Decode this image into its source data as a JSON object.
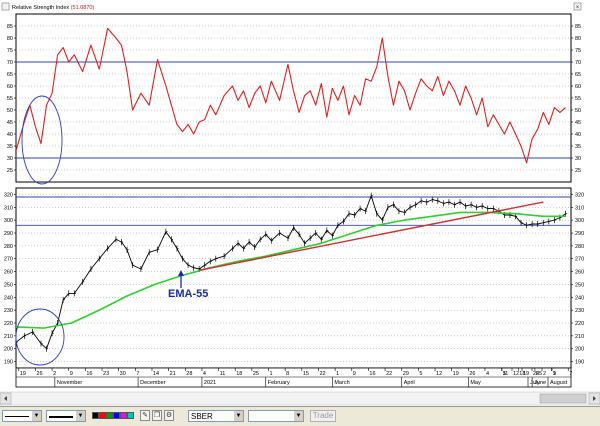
{
  "chart_data": [
    {
      "type": "line",
      "title": "Relative Strength Index",
      "current_value": "(51.0870)",
      "ylim": [
        20,
        90
      ],
      "yticks": [
        25,
        30,
        35,
        40,
        45,
        50,
        55,
        60,
        65,
        70,
        75,
        80,
        85
      ],
      "reference_lines": [
        30,
        70
      ],
      "x_index_range": [
        0,
        200
      ],
      "series": [
        {
          "color": "#e02020",
          "x": [
            0,
            3,
            5,
            7,
            9,
            11,
            13,
            15,
            17,
            19,
            21,
            24,
            27,
            30,
            33,
            36,
            38,
            40,
            42,
            45,
            48,
            51,
            54,
            56,
            58,
            60,
            62,
            64,
            66,
            68,
            70,
            72,
            75,
            78,
            80,
            82,
            84,
            86,
            88,
            90,
            92,
            95,
            98,
            100,
            102,
            104,
            106,
            108,
            110,
            112,
            114,
            116,
            118,
            120,
            122,
            124,
            126,
            128,
            130,
            132,
            134,
            136,
            138,
            140,
            142,
            144,
            146,
            148,
            150,
            152,
            154,
            156,
            158,
            160,
            162,
            164,
            166,
            168,
            170,
            172,
            174,
            176,
            178,
            180,
            182,
            184,
            186,
            188,
            190,
            192,
            194,
            196,
            198
          ],
          "values": [
            33,
            45,
            52,
            43,
            36,
            52,
            57,
            73,
            76,
            70,
            73,
            66,
            77,
            67,
            84,
            80,
            77,
            66,
            50,
            57,
            52,
            71,
            60,
            52,
            44,
            41,
            44,
            40,
            45,
            46,
            52,
            48,
            56,
            60,
            54,
            58,
            51,
            57,
            60,
            53,
            62,
            54,
            69,
            58,
            49,
            56,
            58,
            52,
            61,
            47,
            59,
            54,
            60,
            48,
            56,
            52,
            63,
            62,
            68,
            80,
            64,
            52,
            62,
            58,
            50,
            57,
            63,
            60,
            58,
            64,
            56,
            62,
            58,
            52,
            60,
            55,
            48,
            55,
            43,
            48,
            44,
            40,
            45,
            40,
            35,
            28,
            38,
            42,
            49,
            44,
            51,
            49,
            51
          ]
        }
      ],
      "annotation": "circle around the October low"
    },
    {
      "type": "line",
      "ticker": "SBER",
      "ylim": [
        185,
        325
      ],
      "yticks": [
        190,
        200,
        210,
        220,
        230,
        240,
        250,
        260,
        270,
        280,
        290,
        300,
        310,
        320
      ],
      "reference_lines": [
        296,
        318
      ],
      "x_index_range": [
        0,
        200
      ],
      "series": [
        {
          "color": "#000000",
          "x": [
            0,
            3,
            6,
            9,
            11,
            13,
            15,
            17,
            19,
            21,
            24,
            27,
            30,
            33,
            36,
            38,
            40,
            42,
            45,
            48,
            51,
            54,
            56,
            58,
            60,
            62,
            64,
            66,
            68,
            70,
            72,
            75,
            78,
            80,
            82,
            84,
            86,
            88,
            90,
            92,
            95,
            98,
            100,
            102,
            104,
            106,
            108,
            110,
            112,
            114,
            116,
            118,
            120,
            122,
            124,
            126,
            128,
            130,
            132,
            134,
            136,
            138,
            140,
            142,
            144,
            146,
            148,
            150,
            152,
            154,
            156,
            158,
            160,
            162,
            164,
            166,
            168,
            170,
            172,
            174,
            176,
            178,
            180,
            182,
            184,
            186,
            188,
            190,
            192,
            194,
            196,
            198
          ],
          "values": [
            205,
            210,
            213,
            204,
            200,
            212,
            220,
            238,
            243,
            243,
            252,
            262,
            270,
            278,
            285,
            283,
            277,
            265,
            262,
            275,
            277,
            291,
            285,
            278,
            270,
            265,
            263,
            262,
            265,
            268,
            270,
            272,
            278,
            282,
            278,
            283,
            279,
            285,
            289,
            284,
            290,
            286,
            294,
            289,
            282,
            286,
            290,
            285,
            292,
            288,
            296,
            299,
            305,
            304,
            309,
            307,
            319,
            305,
            300,
            310,
            312,
            307,
            306,
            310,
            312,
            315,
            314,
            316,
            315,
            313,
            314,
            312,
            314,
            311,
            312,
            310,
            311,
            309,
            309,
            307,
            304,
            304,
            303,
            298,
            296,
            297,
            297,
            298,
            299,
            300,
            302,
            305
          ]
        },
        {
          "name": "EMA-55",
          "color": "#33cc33",
          "x": [
            0,
            10,
            20,
            30,
            40,
            50,
            60,
            70,
            80,
            90,
            100,
            110,
            120,
            130,
            140,
            150,
            160,
            170,
            180,
            190,
            198
          ],
          "values": [
            217,
            216,
            220,
            230,
            241,
            250,
            257,
            263,
            268,
            272,
            277,
            282,
            289,
            296,
            300,
            303,
            306,
            306,
            305,
            303,
            303
          ]
        },
        {
          "color": "#c83232",
          "x": [
            66,
            190
          ],
          "values": [
            261,
            314
          ]
        }
      ],
      "annotation": "EMA-55"
    }
  ],
  "x_axis": {
    "days": [
      {
        "label": "19",
        "x": 1
      },
      {
        "label": "26",
        "x": 7
      },
      {
        "label": "2",
        "x": 13
      },
      {
        "label": "9",
        "x": 19
      },
      {
        "label": "16",
        "x": 25
      },
      {
        "label": "23",
        "x": 31
      },
      {
        "label": "30",
        "x": 37
      },
      {
        "label": "7",
        "x": 43
      },
      {
        "label": "14",
        "x": 49
      },
      {
        "label": "21",
        "x": 55
      },
      {
        "label": "28",
        "x": 61
      },
      {
        "label": "4",
        "x": 67
      },
      {
        "label": "11",
        "x": 73
      },
      {
        "label": "18",
        "x": 79
      },
      {
        "label": "25",
        "x": 85
      },
      {
        "label": "1",
        "x": 91
      },
      {
        "label": "8",
        "x": 97
      },
      {
        "label": "15",
        "x": 103
      },
      {
        "label": "22",
        "x": 109
      },
      {
        "label": "1",
        "x": 115
      },
      {
        "label": "9",
        "x": 121
      },
      {
        "label": "16",
        "x": 127
      },
      {
        "label": "22",
        "x": 133
      },
      {
        "label": "29",
        "x": 139
      },
      {
        "label": "5",
        "x": 145
      },
      {
        "label": "12",
        "x": 151
      },
      {
        "label": "19",
        "x": 157
      },
      {
        "label": "26",
        "x": 163
      },
      {
        "label": "4",
        "x": 169
      },
      {
        "label": "11",
        "x": 175
      },
      {
        "label": "18",
        "x": 181
      },
      {
        "label": "25",
        "x": 187
      },
      {
        "label": "1",
        "x": 193
      },
      {
        "label": "7",
        "x": 199
      }
    ],
    "months": [
      {
        "label": "November",
        "x": 14
      },
      {
        "label": "December",
        "x": 44
      },
      {
        "label": "2021",
        "x": 67
      },
      {
        "label": "February",
        "x": 90
      },
      {
        "label": "March",
        "x": 114
      },
      {
        "label": "April",
        "x": 139
      },
      {
        "label": "May",
        "x": 163
      },
      {
        "label": "June",
        "x": 186
      }
    ],
    "right_cut_days": [
      {
        "label": "5",
        "x": 0
      },
      {
        "label": "12",
        "x": 1
      },
      {
        "label": "19",
        "x": 2
      },
      {
        "label": "26",
        "x": 3
      },
      {
        "label": "2",
        "x": 4
      },
      {
        "label": "9",
        "x": 5
      }
    ],
    "right_cut_months": [
      {
        "label": "July",
        "x": 2
      },
      {
        "label": "August",
        "x": 4
      }
    ]
  },
  "toolbar": {
    "ticker_value": "SBER",
    "trade_label": "Trade"
  }
}
